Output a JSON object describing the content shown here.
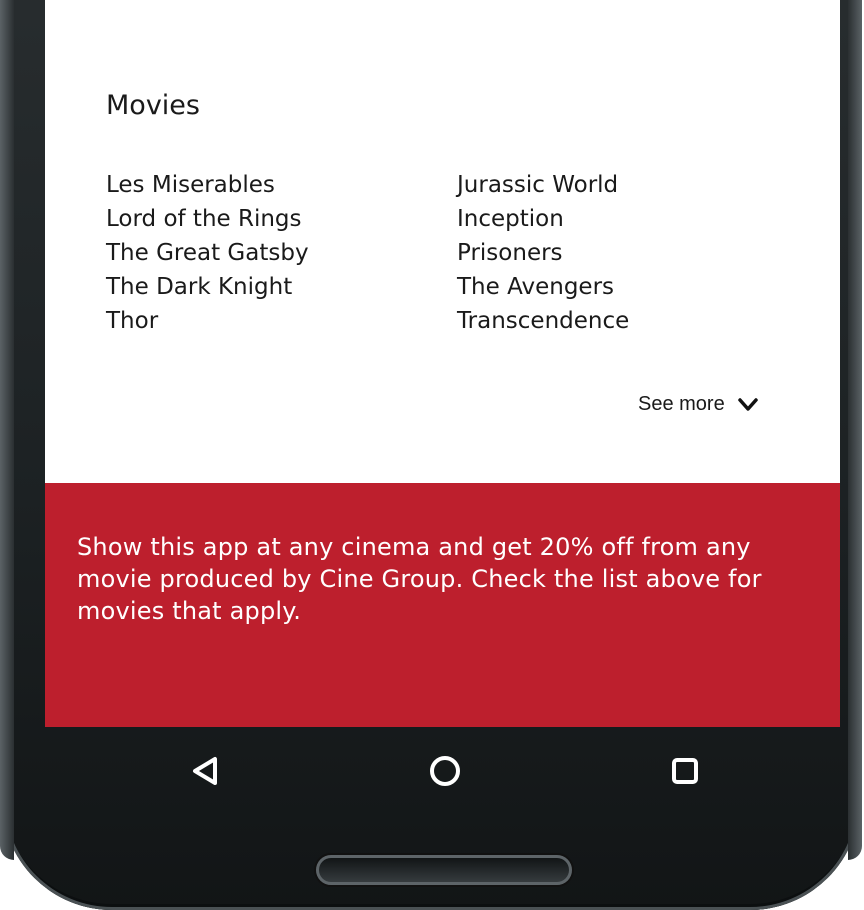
{
  "movies_section": {
    "title": "Movies",
    "left_column": [
      "Les Miserables",
      "Lord of the Rings",
      "The Great Gatsby",
      "The Dark Knight",
      "Thor"
    ],
    "right_column": [
      "Jurassic World",
      "Inception",
      "Prisoners",
      "The Avengers",
      "Transcendence"
    ],
    "see_more_label": "See more",
    "see_more_icon": "chevron-down-icon"
  },
  "promo": {
    "text": "Show this app at any cinema and get 20% off from any movie produced by Cine Group. Check the list above for movies that apply.",
    "background_color": "#bd1f2d",
    "text_color": "#ffffff"
  },
  "navigation_bar": {
    "back_icon": "back-triangle-icon",
    "home_icon": "home-circle-icon",
    "recents_icon": "recents-square-icon"
  }
}
